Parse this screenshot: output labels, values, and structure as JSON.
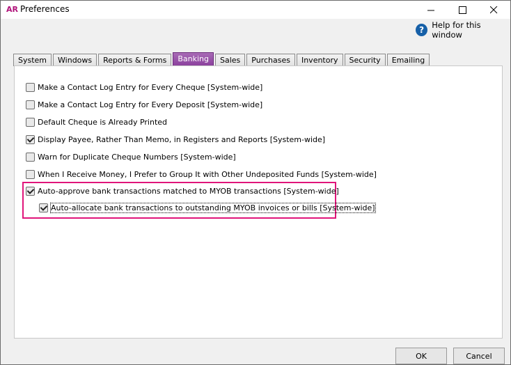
{
  "window": {
    "app_logo": "AR",
    "title": "Preferences",
    "help_text": "Help for this window",
    "help_glyph": "?"
  },
  "tabs": [
    {
      "label": "System",
      "active": false
    },
    {
      "label": "Windows",
      "active": false
    },
    {
      "label": "Reports & Forms",
      "active": false
    },
    {
      "label": "Banking",
      "active": true
    },
    {
      "label": "Sales",
      "active": false
    },
    {
      "label": "Purchases",
      "active": false
    },
    {
      "label": "Inventory",
      "active": false
    },
    {
      "label": "Security",
      "active": false
    },
    {
      "label": "Emailing",
      "active": false
    }
  ],
  "options": [
    {
      "label": "Make a Contact Log Entry for Every Cheque [System-wide]",
      "checked": false
    },
    {
      "label": "Make a Contact Log Entry for Every Deposit [System-wide]",
      "checked": false
    },
    {
      "label": "Default Cheque is Already Printed",
      "checked": false
    },
    {
      "label": "Display Payee, Rather Than Memo, in Registers and Reports [System-wide]",
      "checked": true
    },
    {
      "label": "Warn for Duplicate Cheque Numbers [System-wide]",
      "checked": false
    },
    {
      "label": "When I Receive Money, I Prefer to Group It with Other Undeposited Funds [System-wide]",
      "checked": false
    },
    {
      "label": "Auto-approve bank transactions matched to MYOB transactions [System-wide]",
      "checked": true
    },
    {
      "label": "Auto-allocate bank transactions to outstanding MYOB invoices or bills [System-wide]",
      "checked": true
    }
  ],
  "buttons": {
    "ok": "OK",
    "cancel": "Cancel"
  },
  "colors": {
    "highlight": "#e0157a",
    "active_tab": "#8a3e9c",
    "logo": "#b0127a"
  }
}
